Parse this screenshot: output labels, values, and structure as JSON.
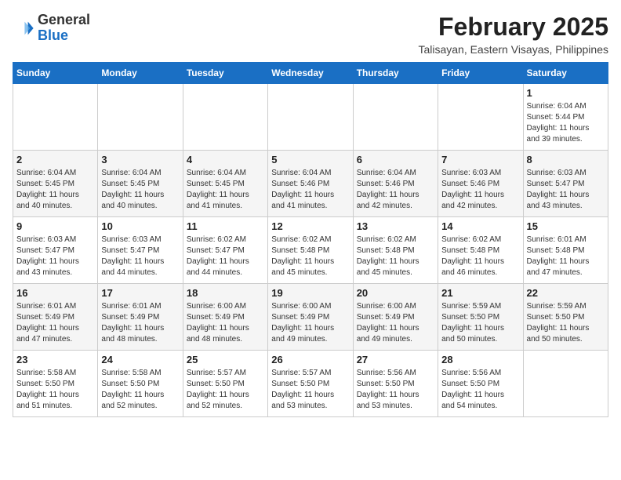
{
  "header": {
    "logo_general": "General",
    "logo_blue": "Blue",
    "month_title": "February 2025",
    "location": "Talisayan, Eastern Visayas, Philippines"
  },
  "days_of_week": [
    "Sunday",
    "Monday",
    "Tuesday",
    "Wednesday",
    "Thursday",
    "Friday",
    "Saturday"
  ],
  "weeks": [
    [
      {
        "day": "",
        "info": ""
      },
      {
        "day": "",
        "info": ""
      },
      {
        "day": "",
        "info": ""
      },
      {
        "day": "",
        "info": ""
      },
      {
        "day": "",
        "info": ""
      },
      {
        "day": "",
        "info": ""
      },
      {
        "day": "1",
        "info": "Sunrise: 6:04 AM\nSunset: 5:44 PM\nDaylight: 11 hours\nand 39 minutes."
      }
    ],
    [
      {
        "day": "2",
        "info": "Sunrise: 6:04 AM\nSunset: 5:45 PM\nDaylight: 11 hours\nand 40 minutes."
      },
      {
        "day": "3",
        "info": "Sunrise: 6:04 AM\nSunset: 5:45 PM\nDaylight: 11 hours\nand 40 minutes."
      },
      {
        "day": "4",
        "info": "Sunrise: 6:04 AM\nSunset: 5:45 PM\nDaylight: 11 hours\nand 41 minutes."
      },
      {
        "day": "5",
        "info": "Sunrise: 6:04 AM\nSunset: 5:46 PM\nDaylight: 11 hours\nand 41 minutes."
      },
      {
        "day": "6",
        "info": "Sunrise: 6:04 AM\nSunset: 5:46 PM\nDaylight: 11 hours\nand 42 minutes."
      },
      {
        "day": "7",
        "info": "Sunrise: 6:03 AM\nSunset: 5:46 PM\nDaylight: 11 hours\nand 42 minutes."
      },
      {
        "day": "8",
        "info": "Sunrise: 6:03 AM\nSunset: 5:47 PM\nDaylight: 11 hours\nand 43 minutes."
      }
    ],
    [
      {
        "day": "9",
        "info": "Sunrise: 6:03 AM\nSunset: 5:47 PM\nDaylight: 11 hours\nand 43 minutes."
      },
      {
        "day": "10",
        "info": "Sunrise: 6:03 AM\nSunset: 5:47 PM\nDaylight: 11 hours\nand 44 minutes."
      },
      {
        "day": "11",
        "info": "Sunrise: 6:02 AM\nSunset: 5:47 PM\nDaylight: 11 hours\nand 44 minutes."
      },
      {
        "day": "12",
        "info": "Sunrise: 6:02 AM\nSunset: 5:48 PM\nDaylight: 11 hours\nand 45 minutes."
      },
      {
        "day": "13",
        "info": "Sunrise: 6:02 AM\nSunset: 5:48 PM\nDaylight: 11 hours\nand 45 minutes."
      },
      {
        "day": "14",
        "info": "Sunrise: 6:02 AM\nSunset: 5:48 PM\nDaylight: 11 hours\nand 46 minutes."
      },
      {
        "day": "15",
        "info": "Sunrise: 6:01 AM\nSunset: 5:48 PM\nDaylight: 11 hours\nand 47 minutes."
      }
    ],
    [
      {
        "day": "16",
        "info": "Sunrise: 6:01 AM\nSunset: 5:49 PM\nDaylight: 11 hours\nand 47 minutes."
      },
      {
        "day": "17",
        "info": "Sunrise: 6:01 AM\nSunset: 5:49 PM\nDaylight: 11 hours\nand 48 minutes."
      },
      {
        "day": "18",
        "info": "Sunrise: 6:00 AM\nSunset: 5:49 PM\nDaylight: 11 hours\nand 48 minutes."
      },
      {
        "day": "19",
        "info": "Sunrise: 6:00 AM\nSunset: 5:49 PM\nDaylight: 11 hours\nand 49 minutes."
      },
      {
        "day": "20",
        "info": "Sunrise: 6:00 AM\nSunset: 5:49 PM\nDaylight: 11 hours\nand 49 minutes."
      },
      {
        "day": "21",
        "info": "Sunrise: 5:59 AM\nSunset: 5:50 PM\nDaylight: 11 hours\nand 50 minutes."
      },
      {
        "day": "22",
        "info": "Sunrise: 5:59 AM\nSunset: 5:50 PM\nDaylight: 11 hours\nand 50 minutes."
      }
    ],
    [
      {
        "day": "23",
        "info": "Sunrise: 5:58 AM\nSunset: 5:50 PM\nDaylight: 11 hours\nand 51 minutes."
      },
      {
        "day": "24",
        "info": "Sunrise: 5:58 AM\nSunset: 5:50 PM\nDaylight: 11 hours\nand 52 minutes."
      },
      {
        "day": "25",
        "info": "Sunrise: 5:57 AM\nSunset: 5:50 PM\nDaylight: 11 hours\nand 52 minutes."
      },
      {
        "day": "26",
        "info": "Sunrise: 5:57 AM\nSunset: 5:50 PM\nDaylight: 11 hours\nand 53 minutes."
      },
      {
        "day": "27",
        "info": "Sunrise: 5:56 AM\nSunset: 5:50 PM\nDaylight: 11 hours\nand 53 minutes."
      },
      {
        "day": "28",
        "info": "Sunrise: 5:56 AM\nSunset: 5:50 PM\nDaylight: 11 hours\nand 54 minutes."
      },
      {
        "day": "",
        "info": ""
      }
    ]
  ]
}
